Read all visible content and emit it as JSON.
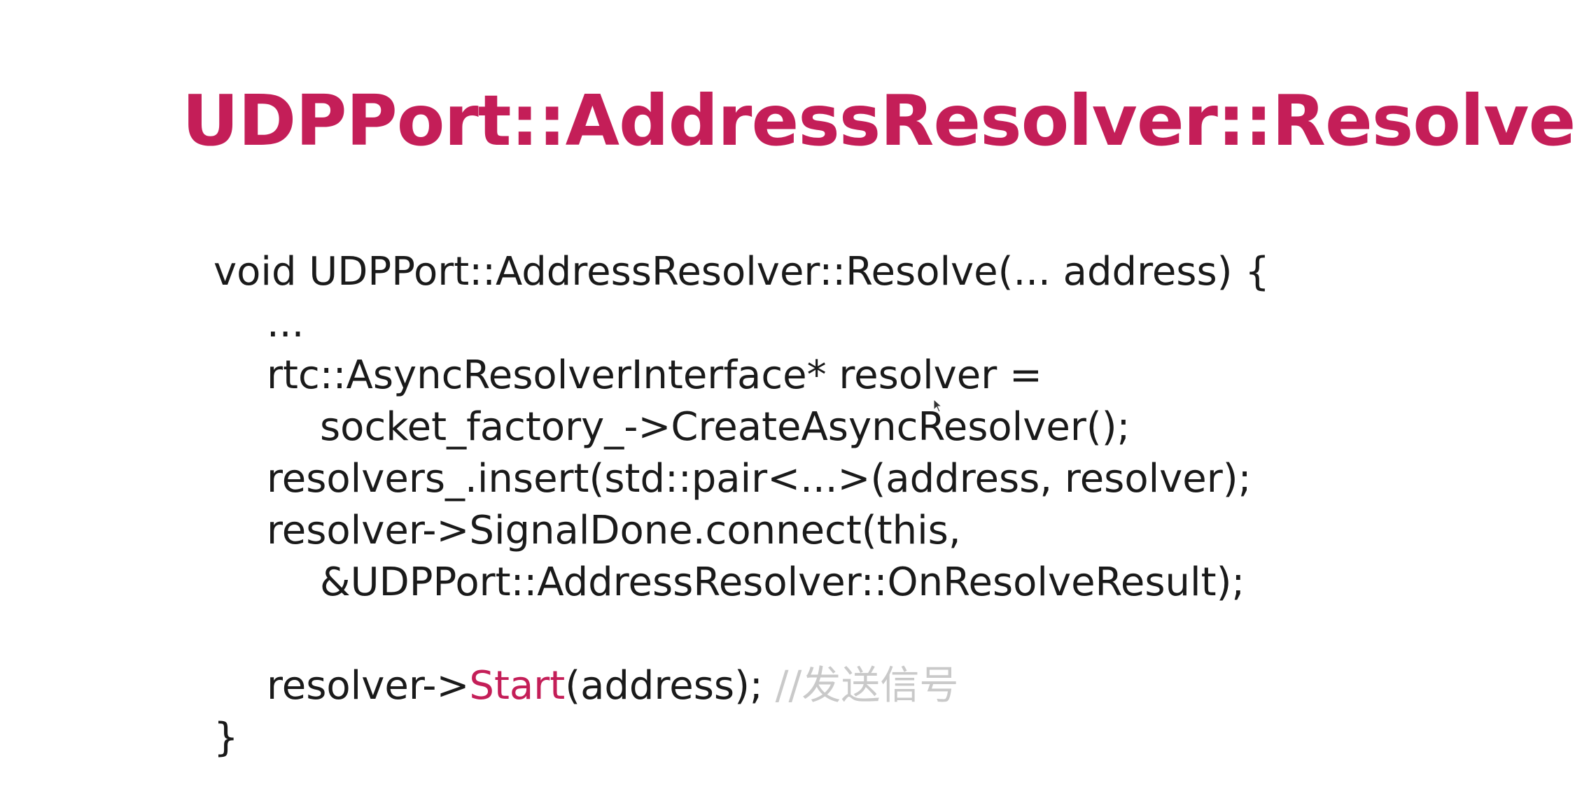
{
  "title": "UDPPort::AddressResolver::Resolve",
  "code": {
    "line1": "void UDPPort::AddressResolver::Resolve(... address) {",
    "line2": "...",
    "line3": "rtc::AsyncResolverInterface* resolver =",
    "line4": "socket_factory_->CreateAsyncResolver();",
    "line5": "resolvers_.insert(std::pair<...>(address, resolver);",
    "line6": "resolver->SignalDone.connect(this,",
    "line7": "&UDPPort::AddressResolver::OnResolveResult);",
    "line9_prefix": "resolver->",
    "line9_method": "Start",
    "line9_args": "(address);",
    "line9_comment": " //发送信号",
    "line10": "}"
  },
  "colors": {
    "accent": "#c41e58",
    "text": "#1a1a1a",
    "comment": "#c9c9c9",
    "background": "#ffffff"
  },
  "icons": {
    "cursor": "mouse-pointer-icon"
  }
}
